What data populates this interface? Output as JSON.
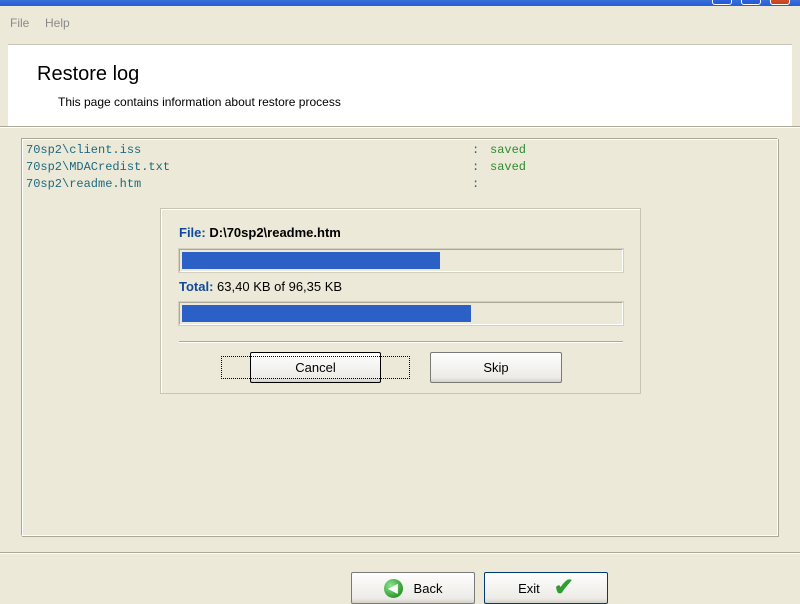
{
  "menu": {
    "file": "File",
    "help": "Help"
  },
  "header": {
    "title": "Restore log",
    "subtitle": "This page contains information about restore process"
  },
  "log": [
    {
      "path": "70sp2\\client.iss",
      "sep": ":",
      "status": "saved"
    },
    {
      "path": "70sp2\\MDACredist.txt",
      "sep": ":",
      "status": "saved"
    },
    {
      "path": "70sp2\\readme.htm",
      "sep": ":",
      "status": ""
    }
  ],
  "progress": {
    "file_label": "File:",
    "file_value": "D:\\70sp2\\readme.htm",
    "file_fraction": 0.59,
    "total_label": "Total:",
    "total_value": "63,40 KB of 96,35 KB",
    "total_fraction": 0.66,
    "cancel": "Cancel",
    "skip": "Skip"
  },
  "nav": {
    "back": "Back",
    "exit": "Exit"
  },
  "icons": {
    "back": "back-arrow-icon",
    "exit": "checkmark-icon"
  },
  "colors": {
    "progress_fill": "#2b61c7",
    "path_text": "#1d6a80",
    "status_text": "#2e8b2e",
    "key_label": "#0f4a9a"
  }
}
